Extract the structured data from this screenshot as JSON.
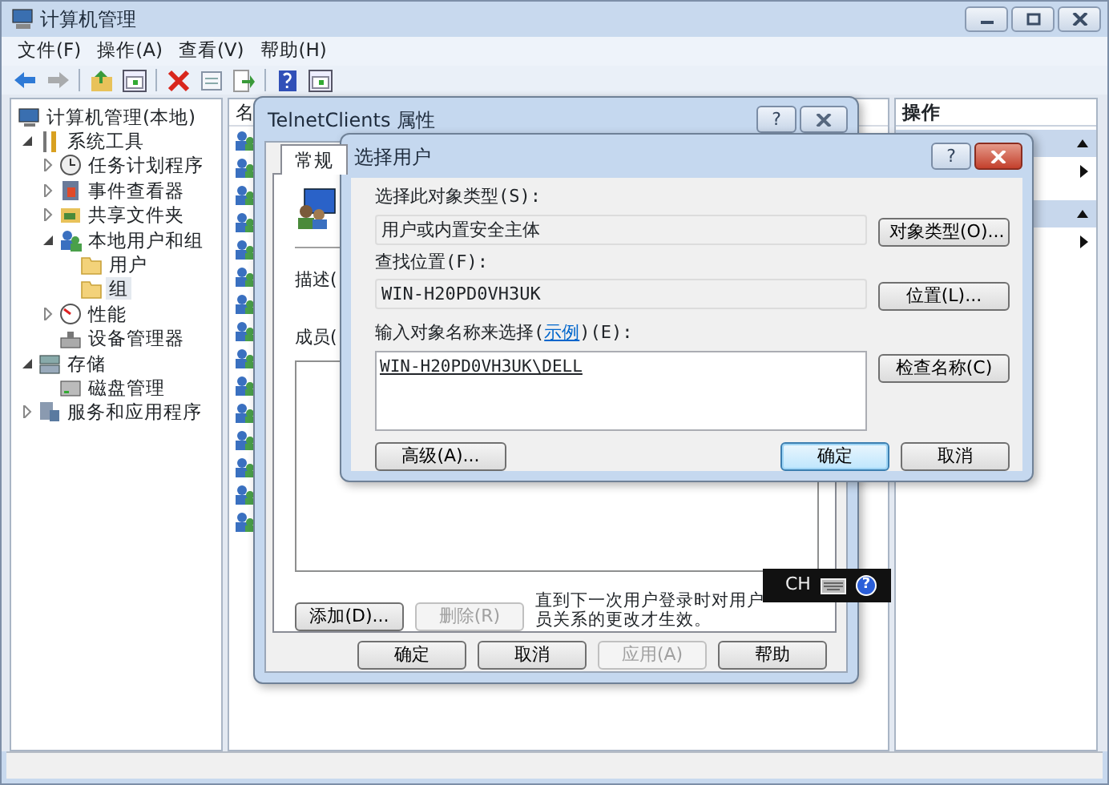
{
  "main_window": {
    "title": "计算机管理",
    "menu": [
      "文件(F)",
      "操作(A)",
      "查看(V)",
      "帮助(H)"
    ],
    "toolbar": [
      {
        "kind": "back",
        "disabled": false
      },
      {
        "kind": "forward",
        "disabled": true
      },
      {
        "kind": "sep"
      },
      {
        "kind": "up"
      },
      {
        "kind": "panel"
      },
      {
        "kind": "sep"
      },
      {
        "kind": "delete"
      },
      {
        "kind": "props"
      },
      {
        "kind": "export"
      },
      {
        "kind": "sep"
      },
      {
        "kind": "help"
      },
      {
        "kind": "panel"
      }
    ],
    "tree": [
      {
        "label": "计算机管理(本地)",
        "kind": "computer",
        "selected": false,
        "children": [
          {
            "label": "系统工具",
            "kind": "tools",
            "expanded": true,
            "selected": false,
            "children": [
              {
                "label": "任务计划程序",
                "kind": "clock",
                "expanded": false,
                "selected": false
              },
              {
                "label": "事件查看器",
                "kind": "log",
                "expanded": false,
                "selected": false
              },
              {
                "label": "共享文件夹",
                "kind": "share",
                "expanded": false,
                "selected": false
              },
              {
                "label": "本地用户和组",
                "kind": "users",
                "expanded": true,
                "selected": false,
                "children": [
                  {
                    "label": "用户",
                    "kind": "folder",
                    "selected": false
                  },
                  {
                    "label": "组",
                    "kind": "folder",
                    "selected": true
                  }
                ]
              },
              {
                "label": "性能",
                "kind": "gauge",
                "expanded": false,
                "selected": false
              },
              {
                "label": "设备管理器",
                "kind": "device",
                "selected": false
              }
            ]
          },
          {
            "label": "存储",
            "kind": "storage",
            "expanded": true,
            "selected": false,
            "children": [
              {
                "label": "磁盘管理",
                "kind": "disk",
                "selected": false
              }
            ]
          },
          {
            "label": "服务和应用程序",
            "kind": "services",
            "expanded": false,
            "selected": false
          }
        ]
      }
    ],
    "list": {
      "column": "名",
      "rows": [
        {
          "kind": "group"
        },
        {
          "kind": "group"
        },
        {
          "kind": "group"
        },
        {
          "kind": "group"
        },
        {
          "kind": "group"
        },
        {
          "kind": "group"
        },
        {
          "kind": "group"
        },
        {
          "kind": "group"
        },
        {
          "kind": "group"
        },
        {
          "kind": "group"
        },
        {
          "kind": "group"
        },
        {
          "kind": "group"
        },
        {
          "kind": "group"
        },
        {
          "kind": "group"
        },
        {
          "kind": "group"
        }
      ]
    },
    "actions": {
      "header": "操作",
      "sections": [
        {
          "expanded": true,
          "items": [
            {
              "kind": "submenu"
            }
          ]
        },
        {
          "expanded": true,
          "items": [
            {
              "kind": "submenu"
            }
          ]
        }
      ]
    }
  },
  "properties_dialog": {
    "title": "TelnetClients 属性",
    "help_glyph": "?",
    "tabs": [
      {
        "label": "常规",
        "selected": true
      }
    ],
    "description_label": "描述(",
    "members_label": "成员(",
    "member_buttons": [
      {
        "label": "添加(D)...",
        "disabled": false
      },
      {
        "label": "删除(R)",
        "disabled": true
      }
    ],
    "note_lines": [
      "直到下一次用户登录时对用户",
      "员关系的更改才生效。"
    ],
    "buttons": [
      {
        "label": "确定",
        "disabled": false
      },
      {
        "label": "取消",
        "disabled": false
      },
      {
        "label": "应用(A)",
        "disabled": true
      },
      {
        "label": "帮助",
        "disabled": false
      }
    ]
  },
  "select_user_dialog": {
    "title": "选择用户",
    "help_glyph": "?",
    "object_type_label": "选择此对象类型(S):",
    "object_type_value": "用户或内置安全主体",
    "object_type_button": "对象类型(O)...",
    "location_label": "查找位置(F):",
    "location_value": "WIN-H20PD0VH3UK",
    "location_button": "位置(L)...",
    "name_label_before": "输入对象名称来选择(",
    "example_link": "示例",
    "name_label_after": ")(E):",
    "name_value": "WIN-H20PD0VH3UK\\DELL",
    "check_button": "检查名称(C)",
    "advanced_button": "高级(A)...",
    "buttons": [
      {
        "label": "确定",
        "default": true
      },
      {
        "label": "取消",
        "default": false
      }
    ]
  },
  "ime_bar": {
    "language": "CH",
    "help_glyph": "?"
  }
}
